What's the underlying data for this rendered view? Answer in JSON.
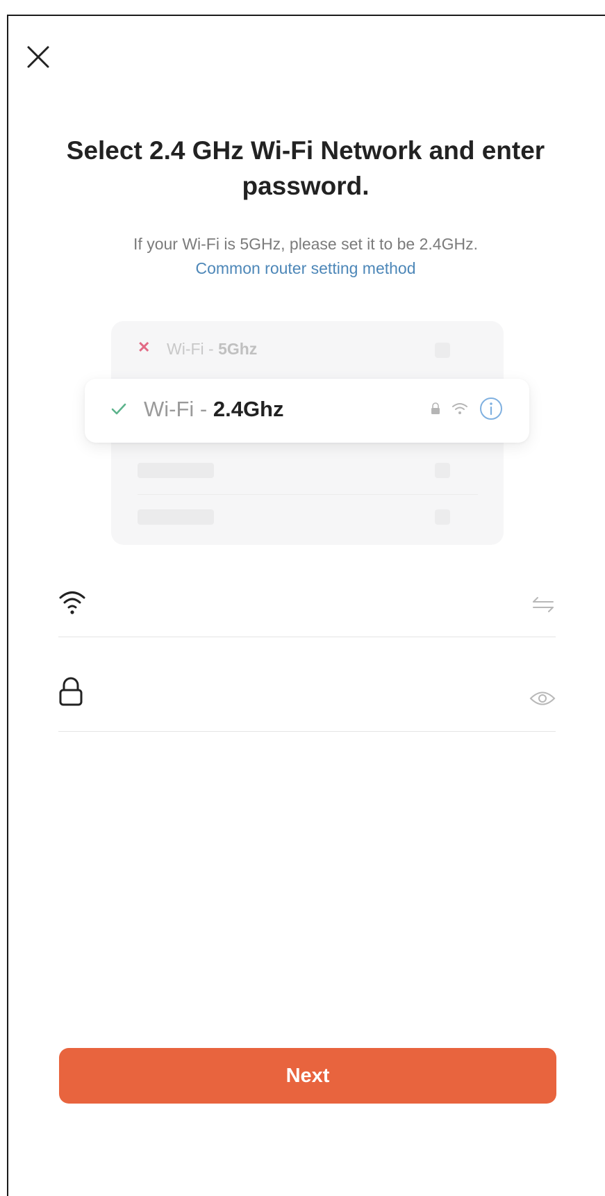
{
  "header": {
    "title": "Select 2.4 GHz Wi-Fi Network and enter password.",
    "subtitle": "If your Wi-Fi is 5GHz, please set it to be 2.4GHz.",
    "router_link": "Common router setting method"
  },
  "illustration": {
    "unsupported": {
      "prefix": "Wi-Fi - ",
      "band": "5Ghz"
    },
    "supported": {
      "prefix": "Wi-Fi - ",
      "band": "2.4Ghz"
    }
  },
  "form": {
    "wifi_name": {
      "value": "",
      "placeholder": ""
    },
    "password": {
      "value": "",
      "placeholder": ""
    }
  },
  "footer": {
    "next_label": "Next"
  },
  "colors": {
    "accent": "#e8643e",
    "link": "#4d87b8",
    "check": "#5cb38c",
    "cross": "#e26a85",
    "info": "#7fb0e0"
  },
  "icons": [
    "close-icon",
    "cross-icon",
    "check-icon",
    "lock-icon",
    "wifi-icon",
    "info-icon",
    "switch-network-icon",
    "eye-icon"
  ]
}
